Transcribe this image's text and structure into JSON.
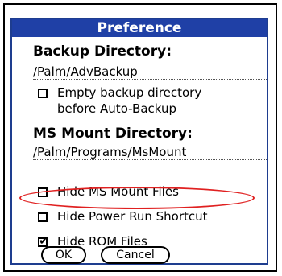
{
  "dialog": {
    "title": "Preference"
  },
  "backup": {
    "heading": "Backup Directory:",
    "path": "/Palm/AdvBackup",
    "empty_label_line1": "Empty backup directory",
    "empty_label_line2": "before Auto-Backup",
    "empty_checked": false
  },
  "ms_mount": {
    "heading": "MS Mount Directory:",
    "path": "/Palm/Programs/MsMount"
  },
  "options": {
    "hide_ms_mount_label": "Hide MS Mount Files",
    "hide_ms_mount_checked": false,
    "hide_power_run_label": "Hide Power Run Shortcut",
    "hide_power_run_checked": false,
    "hide_rom_label": "Hide ROM Files",
    "hide_rom_checked": true
  },
  "buttons": {
    "ok": "OK",
    "cancel": "Cancel"
  },
  "colors": {
    "title_bar": "#1f40a6",
    "highlight": "#e02020"
  }
}
